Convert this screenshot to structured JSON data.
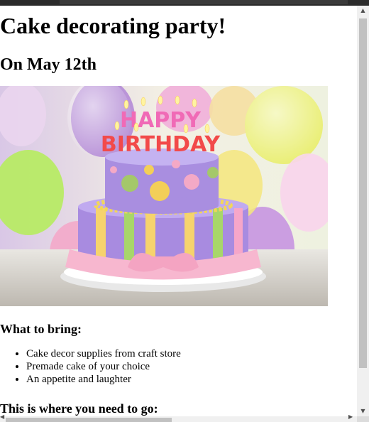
{
  "page": {
    "title": "Cake decorating party!",
    "date": "On May 12th",
    "image": {
      "cake_topper_text_line1": "HAPPY",
      "cake_topper_text_line2": "BIRTHDAY"
    },
    "bring_heading": "What to bring:",
    "bring_items": [
      "Cake decor supplies from craft store",
      "Premade cake of your choice",
      "An appetite and laughter"
    ],
    "location_heading": "This is where you need to go:"
  },
  "scrollbars": {
    "vertical": {
      "up_icon": "arrow-up-icon",
      "down_icon": "arrow-down-icon"
    },
    "horizontal": {
      "left_icon": "arrow-left-icon",
      "right_icon": "arrow-right-icon"
    }
  }
}
